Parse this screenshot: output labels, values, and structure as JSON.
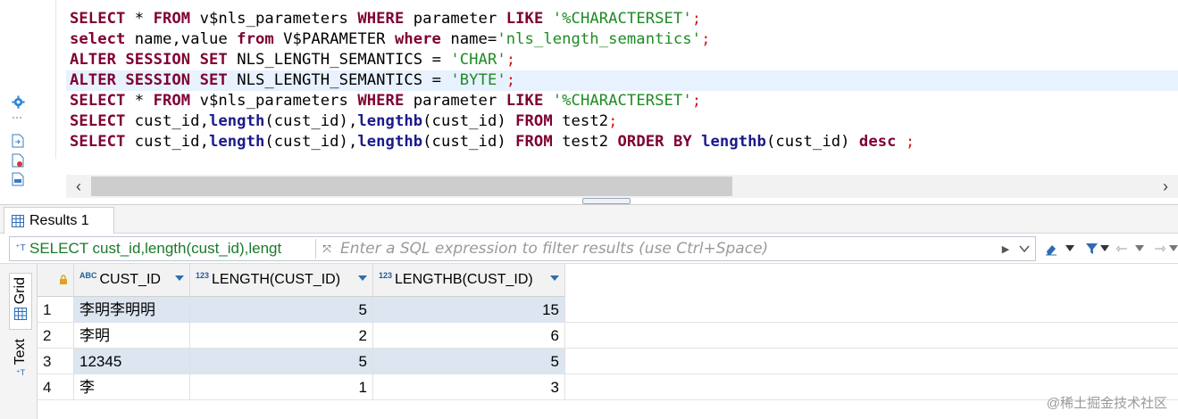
{
  "editor": {
    "lines": [
      [
        {
          "t": "SELECT",
          "c": "kw"
        },
        {
          "t": " * ",
          "c": "id"
        },
        {
          "t": "FROM",
          "c": "kw"
        },
        {
          "t": " v$nls_parameters ",
          "c": "id"
        },
        {
          "t": "WHERE",
          "c": "kw"
        },
        {
          "t": " parameter ",
          "c": "id"
        },
        {
          "t": "LIKE",
          "c": "kw"
        },
        {
          "t": " ",
          "c": "id"
        },
        {
          "t": "'%CHARACTERSET'",
          "c": "str"
        },
        {
          "t": ";",
          "c": "semi"
        }
      ],
      [
        {
          "t": "select",
          "c": "kw"
        },
        {
          "t": " name,value ",
          "c": "id"
        },
        {
          "t": "from",
          "c": "kw"
        },
        {
          "t": " V$PARAMETER ",
          "c": "id"
        },
        {
          "t": "where",
          "c": "kw"
        },
        {
          "t": " name=",
          "c": "id"
        },
        {
          "t": "'nls_length_semantics'",
          "c": "str"
        },
        {
          "t": ";",
          "c": "semi"
        }
      ],
      [
        {
          "t": "ALTER",
          "c": "kw"
        },
        {
          "t": " ",
          "c": "id"
        },
        {
          "t": "SESSION",
          "c": "kw"
        },
        {
          "t": " ",
          "c": "id"
        },
        {
          "t": "SET",
          "c": "kw"
        },
        {
          "t": " NLS_LENGTH_SEMANTICS = ",
          "c": "id"
        },
        {
          "t": "'CHAR'",
          "c": "str"
        },
        {
          "t": ";",
          "c": "semi"
        }
      ],
      [
        {
          "t": "ALTER",
          "c": "kw"
        },
        {
          "t": " ",
          "c": "id"
        },
        {
          "t": "SESSION",
          "c": "kw"
        },
        {
          "t": " ",
          "c": "id"
        },
        {
          "t": "SET",
          "c": "kw"
        },
        {
          "t": " NLS_LENGTH_SEMANTICS = ",
          "c": "id"
        },
        {
          "t": "'BYTE'",
          "c": "str"
        },
        {
          "t": ";",
          "c": "semi"
        }
      ],
      [
        {
          "t": "SELECT",
          "c": "kw"
        },
        {
          "t": " * ",
          "c": "id"
        },
        {
          "t": "FROM",
          "c": "kw"
        },
        {
          "t": " v$nls_parameters ",
          "c": "id"
        },
        {
          "t": "WHERE",
          "c": "kw"
        },
        {
          "t": " parameter ",
          "c": "id"
        },
        {
          "t": "LIKE",
          "c": "kw"
        },
        {
          "t": " ",
          "c": "id"
        },
        {
          "t": "'%CHARACTERSET'",
          "c": "str"
        },
        {
          "t": ";",
          "c": "semi"
        }
      ],
      [
        {
          "t": "SELECT",
          "c": "kw"
        },
        {
          "t": " cust_id,",
          "c": "id"
        },
        {
          "t": "length",
          "c": "fn"
        },
        {
          "t": "(cust_id),",
          "c": "id"
        },
        {
          "t": "lengthb",
          "c": "fn"
        },
        {
          "t": "(cust_id) ",
          "c": "id"
        },
        {
          "t": "FROM",
          "c": "kw"
        },
        {
          "t": " test2",
          "c": "id"
        },
        {
          "t": ";",
          "c": "semi"
        }
      ],
      [
        {
          "t": "SELECT",
          "c": "kw"
        },
        {
          "t": " cust_id,",
          "c": "id"
        },
        {
          "t": "length",
          "c": "fn"
        },
        {
          "t": "(cust_id),",
          "c": "id"
        },
        {
          "t": "lengthb",
          "c": "fn"
        },
        {
          "t": "(cust_id) ",
          "c": "id"
        },
        {
          "t": "FROM",
          "c": "kw"
        },
        {
          "t": " test2 ",
          "c": "id"
        },
        {
          "t": "ORDER",
          "c": "kw"
        },
        {
          "t": " ",
          "c": "id"
        },
        {
          "t": "BY",
          "c": "kw"
        },
        {
          "t": " ",
          "c": "id"
        },
        {
          "t": "lengthb",
          "c": "fn"
        },
        {
          "t": "(cust_id) ",
          "c": "id"
        },
        {
          "t": "desc",
          "c": "kw"
        },
        {
          "t": " ",
          "c": "id"
        },
        {
          "t": ";",
          "c": "semi"
        }
      ]
    ],
    "current_line_index": 3,
    "gutter_icons": [
      "gear-icon",
      "document-arrow-icon",
      "document-error-icon",
      "document-sql-icon"
    ]
  },
  "results": {
    "tab_label": "Results 1",
    "filter_query": "SELECT cust_id,length(cust_id),lengt",
    "filter_placeholder": "Enter a SQL expression to filter results (use Ctrl+Space)",
    "side_tabs": [
      "Grid",
      "Text"
    ],
    "columns": [
      {
        "type": "ABC",
        "name": "CUST_ID"
      },
      {
        "type": "123",
        "name": "LENGTH(CUST_ID)"
      },
      {
        "type": "123",
        "name": "LENGTHB(CUST_ID)"
      }
    ],
    "rows": [
      {
        "n": "1",
        "cust_id": "李明李明明",
        "length": "5",
        "lengthb": "15",
        "selected": true
      },
      {
        "n": "2",
        "cust_id": "李明",
        "length": "2",
        "lengthb": "6",
        "selected": false
      },
      {
        "n": "3",
        "cust_id": "12345",
        "length": "5",
        "lengthb": "5",
        "selected": true
      },
      {
        "n": "4",
        "cust_id": "李",
        "length": "1",
        "lengthb": "3",
        "selected": false
      }
    ]
  },
  "watermark": "@稀土掘金技术社区",
  "colors": {
    "keyword": "#7f0033",
    "function": "#1a1a8c",
    "string": "#1f8b25",
    "accent": "#2d6cb4",
    "row_selected": "#dce5f0"
  }
}
